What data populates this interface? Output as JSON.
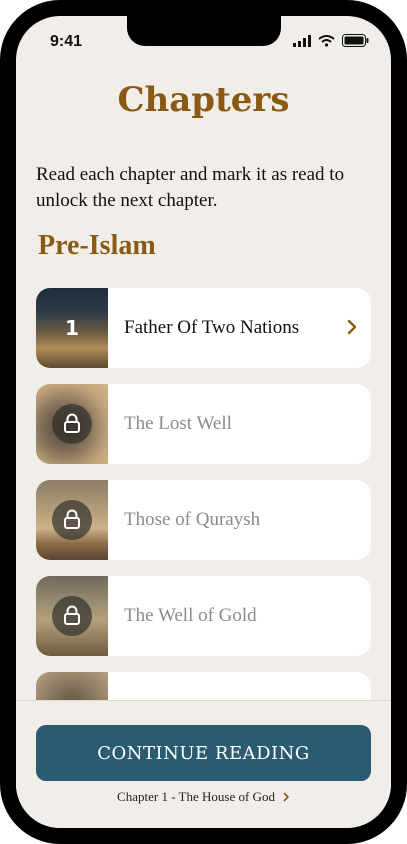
{
  "status": {
    "time": "9:41"
  },
  "page": {
    "title": "Chapters",
    "intro": "Read each chapter and mark it as read to unlock the next chapter.",
    "section_title": "Pre-Islam"
  },
  "chapters": [
    {
      "number": "1",
      "title": "Father Of Two Nations",
      "locked": false
    },
    {
      "number": "",
      "title": "The Lost Well",
      "locked": true
    },
    {
      "number": "",
      "title": "Those of Quraysh",
      "locked": true
    },
    {
      "number": "",
      "title": "The Well of Gold",
      "locked": true
    }
  ],
  "cta": {
    "button_label": "CONTINUE READING",
    "next_chapter": "Chapter 1 - The House of God"
  },
  "colors": {
    "accent": "#8a5a14",
    "primary": "#2b5b70",
    "background": "#f1eee9"
  },
  "icons": [
    "signal-icon",
    "wifi-icon",
    "battery-icon",
    "lock-icon",
    "chevron-right-icon"
  ]
}
